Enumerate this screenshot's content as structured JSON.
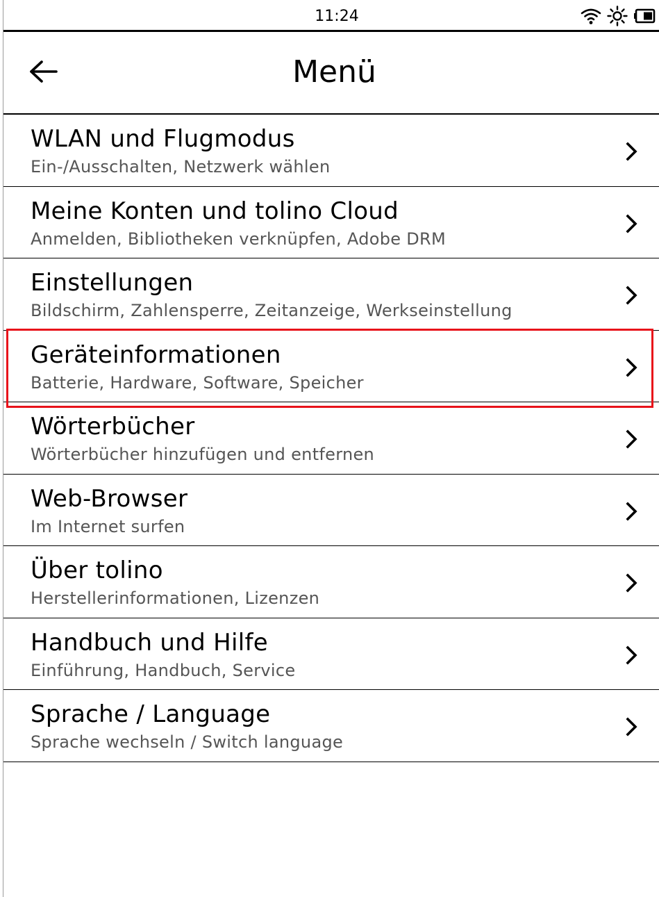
{
  "status_bar": {
    "time": "11:24",
    "icons": [
      "wifi-icon",
      "brightness-icon",
      "battery-icon"
    ]
  },
  "header": {
    "back_icon": "arrow-left-icon",
    "title": "Menü"
  },
  "menu": {
    "items": [
      {
        "title": "WLAN und Flugmodus",
        "subtitle": "Ein-/Ausschalten, Netzwerk wählen"
      },
      {
        "title": "Meine Konten und tolino Cloud",
        "subtitle": "Anmelden, Bibliotheken verknüpfen, Adobe DRM"
      },
      {
        "title": "Einstellungen",
        "subtitle": "Bildschirm, Zahlensperre, Zeitanzeige, Werkseinstellung"
      },
      {
        "title": "Geräteinformationen",
        "subtitle": "Batterie, Hardware, Software, Speicher"
      },
      {
        "title": "Wörterbücher",
        "subtitle": "Wörterbücher hinzufügen und entfernen"
      },
      {
        "title": "Web-Browser",
        "subtitle": "Im Internet surfen"
      },
      {
        "title": "Über tolino",
        "subtitle": "Herstellerinformationen, Lizenzen"
      },
      {
        "title": "Handbuch und Hilfe",
        "subtitle": "Einführung, Handbuch, Service"
      },
      {
        "title": "Sprache / Language",
        "subtitle": "Sprache wechseln / Switch language"
      }
    ],
    "chevron_icon": "chevron-right-icon",
    "highlighted_item": "Geräteinformationen"
  },
  "colors": {
    "highlight": "#e8121a",
    "subtitle_text": "#555555",
    "divider": "#000000"
  }
}
